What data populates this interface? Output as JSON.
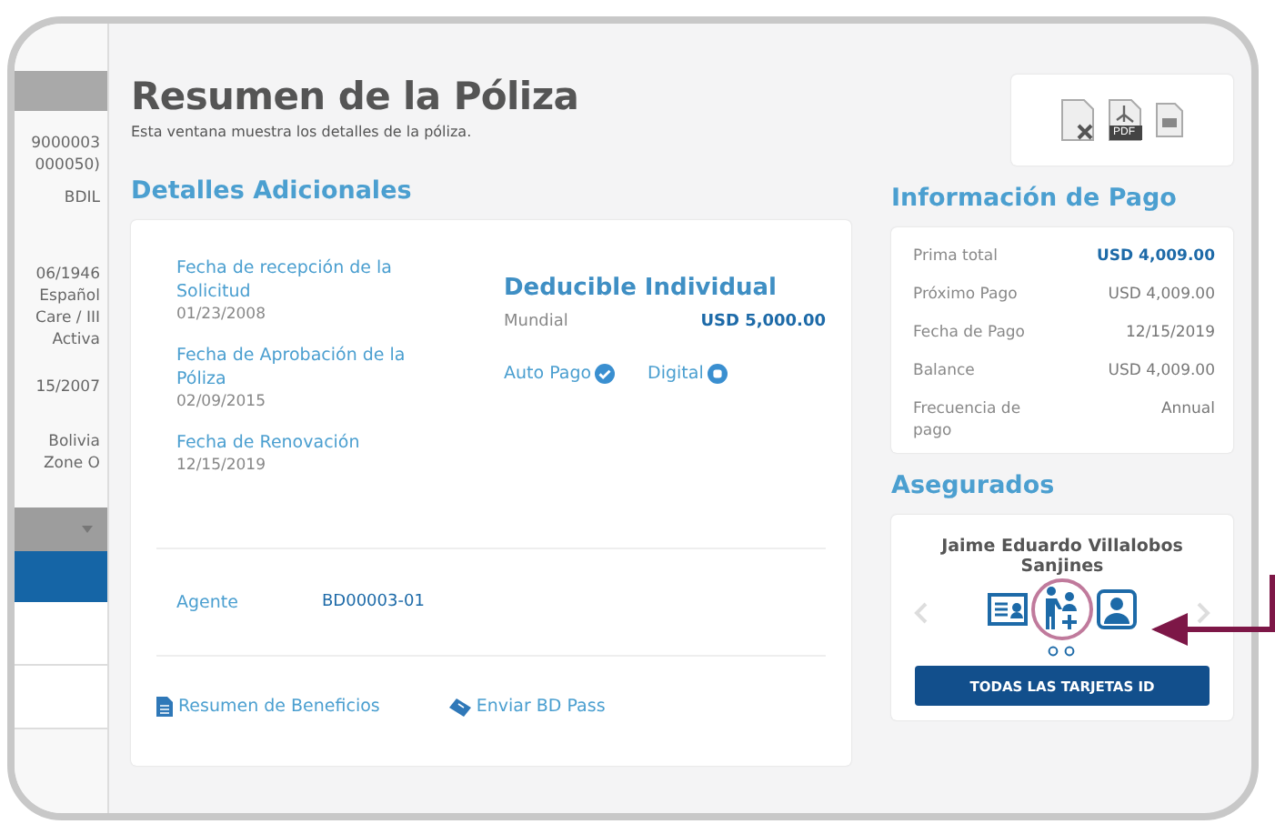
{
  "sidebar": {
    "values": [
      "9000003",
      "000050)",
      "BDIL",
      "06/1946",
      "Español",
      "Care / III",
      "Activa",
      "15/2007",
      "Bolivia",
      "Zone O"
    ]
  },
  "page": {
    "title": "Resumen de la Póliza",
    "subtitle": "Esta ventana muestra los detalles de la póliza."
  },
  "details": {
    "heading": "Detalles Adicionales",
    "fields": [
      {
        "label": "Fecha de recepción de la Solicitud",
        "value": "01/23/2008"
      },
      {
        "label": "Fecha de Aprobación de la Póliza",
        "value": "02/09/2015"
      },
      {
        "label": "Fecha de Renovación",
        "value": "12/15/2019"
      }
    ],
    "deductible": {
      "title": "Deducible Individual",
      "region": "Mundial",
      "amount": "USD 5,000.00"
    },
    "toggles": [
      {
        "label": "Auto Pago",
        "checked": true
      },
      {
        "label": "Digital",
        "checked": false
      }
    ],
    "agent": {
      "label": "Agente",
      "value": "BD00003-01"
    },
    "links": [
      {
        "label": "Resumen de Beneficios",
        "kind": "document"
      },
      {
        "label": "Enviar BD Pass",
        "kind": "ticket"
      }
    ]
  },
  "exports": [
    {
      "kind": "excel"
    },
    {
      "kind": "pdf",
      "label": "PDF"
    },
    {
      "kind": "print"
    }
  ],
  "payment": {
    "heading": "Información de Pago",
    "rows": [
      {
        "label": "Prima total",
        "value": "USD 4,009.00",
        "emphasis": true
      },
      {
        "label": "Próximo Pago",
        "value": "USD 4,009.00",
        "emphasis": false
      },
      {
        "label": "Fecha de Pago",
        "value": "12/15/2019",
        "emphasis": false
      },
      {
        "label": "Balance",
        "value": "USD 4,009.00",
        "emphasis": false
      },
      {
        "label": "Frecuencia de pago",
        "value": "Annual",
        "emphasis": false
      }
    ]
  },
  "insured": {
    "heading": "Asegurados",
    "name": "Jaime Eduardo Villalobos Sanjines",
    "cards": [
      {
        "kind": "id-card",
        "highlighted": false
      },
      {
        "kind": "caregiver",
        "highlighted": true
      },
      {
        "kind": "doctor",
        "highlighted": false
      }
    ],
    "button": "TODAS LAS TARJETAS ID"
  }
}
